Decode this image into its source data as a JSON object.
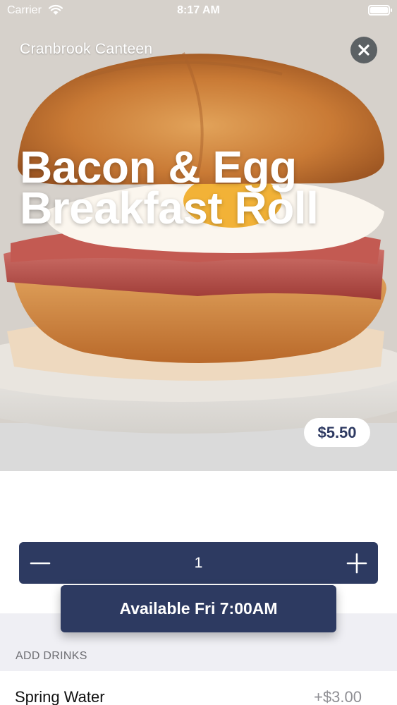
{
  "status_bar": {
    "carrier": "Carrier",
    "time": "8:17 AM"
  },
  "header": {
    "venue": "Cranbrook Canteen",
    "close_icon": "close-icon"
  },
  "item": {
    "title": "Bacon & Egg Breakfast Roll",
    "price": "$5.50"
  },
  "quantity": {
    "value": "1",
    "minus_icon": "minus-icon",
    "plus_icon": "plus-icon"
  },
  "availability": {
    "label": "Available Fri 7:00AM"
  },
  "drinks": {
    "section_label": "ADD DRINKS",
    "items": [
      {
        "name": "Spring Water",
        "price": "+$3.00"
      }
    ]
  },
  "colors": {
    "primary": "#2d3a61",
    "section_bg": "#efeff4",
    "muted_text": "#8e8e93"
  }
}
